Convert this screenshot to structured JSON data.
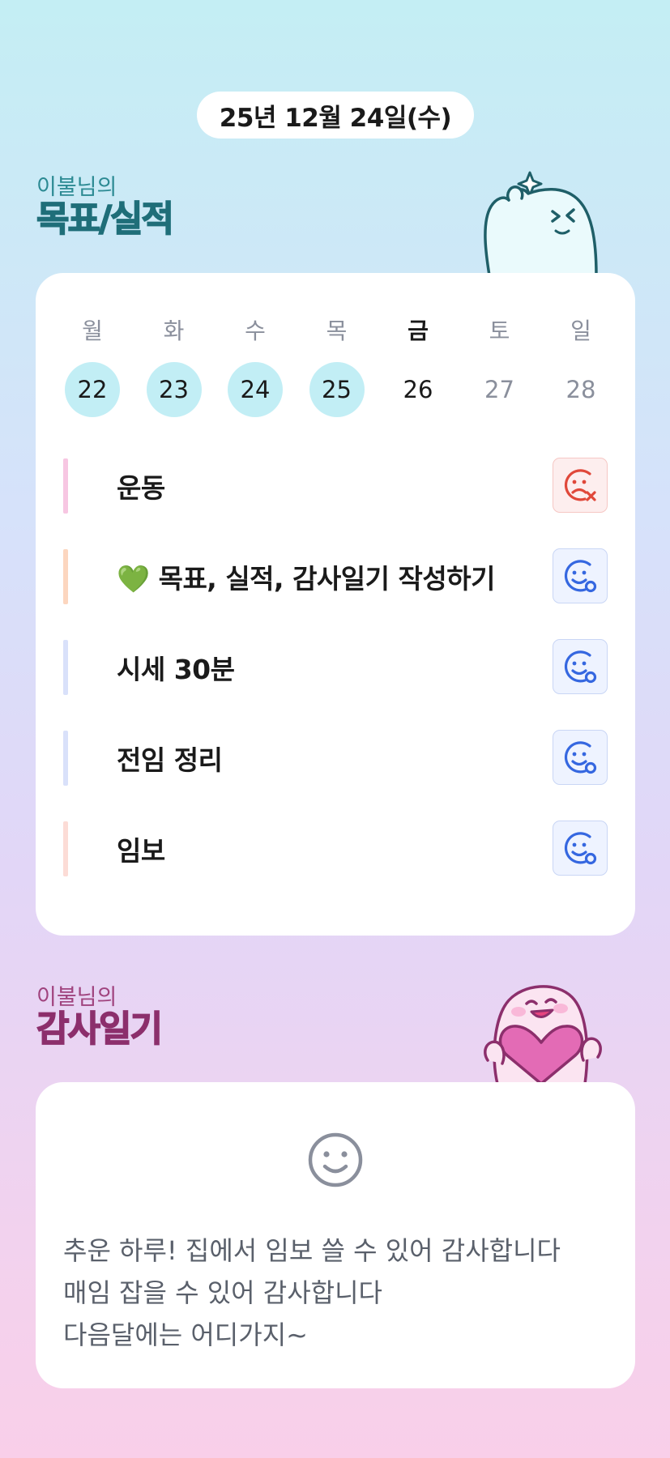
{
  "date_label": "25년 12월 24일(수)",
  "goals_section": {
    "subtitle": "이불님의",
    "title": "목표/실적",
    "mascot": "blue-ghost-mascot"
  },
  "week": [
    {
      "name": "월",
      "num": "22",
      "state": "done"
    },
    {
      "name": "화",
      "num": "23",
      "state": "done"
    },
    {
      "name": "수",
      "num": "24",
      "state": "done"
    },
    {
      "name": "목",
      "num": "25",
      "state": "done"
    },
    {
      "name": "금",
      "num": "26",
      "state": "today"
    },
    {
      "name": "토",
      "num": "27",
      "state": "future"
    },
    {
      "name": "일",
      "num": "28",
      "state": "future"
    }
  ],
  "goals": [
    {
      "label": "운동",
      "bar_color": "#f7c6e2",
      "status": "fail",
      "icon": "sad-face-x-icon"
    },
    {
      "label": "💚 목표, 실적, 감사일기 작성하기",
      "bar_color": "#fcd6bf",
      "status": "ok",
      "icon": "smile-face-o-icon"
    },
    {
      "label": "시세 30분",
      "bar_color": "#d9e1fa",
      "status": "ok",
      "icon": "smile-face-o-icon"
    },
    {
      "label": "전임 정리",
      "bar_color": "#d9e1fa",
      "status": "ok",
      "icon": "smile-face-o-icon"
    },
    {
      "label": "임보",
      "bar_color": "#fcdcd6",
      "status": "ok",
      "icon": "smile-face-o-icon"
    }
  ],
  "gratitude_section": {
    "subtitle": "이불님의",
    "title": "감사일기",
    "mascot": "pink-heart-mascot",
    "icon": "smile-face-icon",
    "lines": [
      "추운 하루! 집에서 임보 쓸 수 있어 감사합니다",
      "매임 잡을 수 있어 감사합니다",
      "다음달에는 어디가지~"
    ]
  },
  "colors": {
    "accent_teal": "#1f6e79",
    "accent_pink": "#8c2f6c",
    "ok_blue": "#3567e0",
    "fail_red": "#e0483a",
    "done_circle": "#c2eef5"
  }
}
